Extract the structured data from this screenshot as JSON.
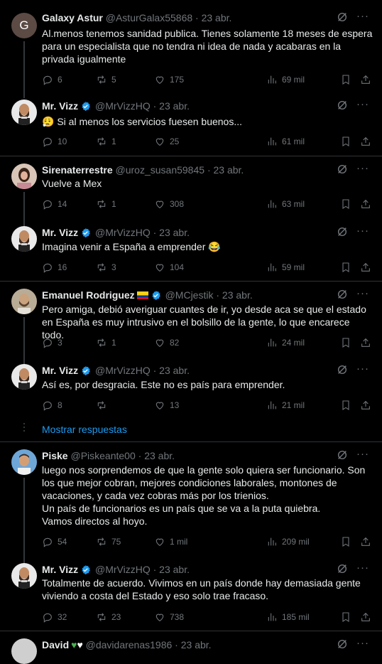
{
  "tweets": [
    {
      "name": "Galaxy Astur",
      "handle": "@AsturGalax55868",
      "date": "23 abr.",
      "avatar_letter": "G",
      "text": "Al.menos tenemos sanidad publica. Tienes solamente 18 meses de espera para un especialista que no tendra ni idea de nada y acabaras en la privada igualmente",
      "replies": "6",
      "retweets": "5",
      "likes": "175",
      "views": "69 mil"
    },
    {
      "name": "Mr. Vizz",
      "handle": "@MrVizzHQ",
      "date": "23 abr.",
      "text": "😮‍💨 Si al menos los servicios fuesen buenos...",
      "replies": "10",
      "retweets": "1",
      "likes": "25",
      "views": "61 mil"
    },
    {
      "name": "Sirenaterrestre",
      "handle": "@uroz_susan59845",
      "date": "23 abr.",
      "text": "Vuelve a Mex",
      "replies": "14",
      "retweets": "1",
      "likes": "308",
      "views": "63 mil"
    },
    {
      "name": "Mr. Vizz",
      "handle": "@MrVizzHQ",
      "date": "23 abr.",
      "text": "Imagina venir a España a emprender 😂",
      "replies": "16",
      "retweets": "3",
      "likes": "104",
      "views": "59 mil"
    },
    {
      "name": "Emanuel Rodriguez",
      "handle": "@MCjestik",
      "date": "23 abr.",
      "text": "Pero amiga, debió averiguar cuantes de ir, yo desde aca se que el estado en España es muy intrusivo en el bolsillo de la gente, lo que encarece todo.",
      "replies": "3",
      "retweets": "1",
      "likes": "82",
      "views": "24 mil"
    },
    {
      "name": "Mr. Vizz",
      "handle": "@MrVizzHQ",
      "date": "23 abr.",
      "text": "Así es, por desgracia. Este no es país para emprender.",
      "replies": "8",
      "retweets": "",
      "likes": "13",
      "views": "21 mil"
    },
    {
      "name": "Piske",
      "handle": "@Piskeante00",
      "date": "23 abr.",
      "text": "luego nos sorprendemos de que la gente solo quiera ser funcionario. Son los que mejor cobran, mejores condiciones laborales, montones de vacaciones, y cada vez cobras más por los trienios.\nUn país de funcionarios es un país que se va a la puta quiebra.\nVamos directos al hoyo.",
      "replies": "54",
      "retweets": "75",
      "likes": "1 mil",
      "views": "209 mil"
    },
    {
      "name": "Mr. Vizz",
      "handle": "@MrVizzHQ",
      "date": "23 abr.",
      "text": "Totalmente de acuerdo. Vivimos en un país donde hay demasiada gente viviendo a costa del Estado y eso solo trae fracaso.",
      "replies": "32",
      "retweets": "23",
      "likes": "738",
      "views": "185 mil"
    },
    {
      "name": "David",
      "handle": "@davidarenas1986",
      "date": "23 abr."
    }
  ],
  "show_replies": "Mostrar respuestas",
  "colors": {
    "accent": "#1d9bf0",
    "muted": "#71767b",
    "separator": "#2f3336"
  }
}
